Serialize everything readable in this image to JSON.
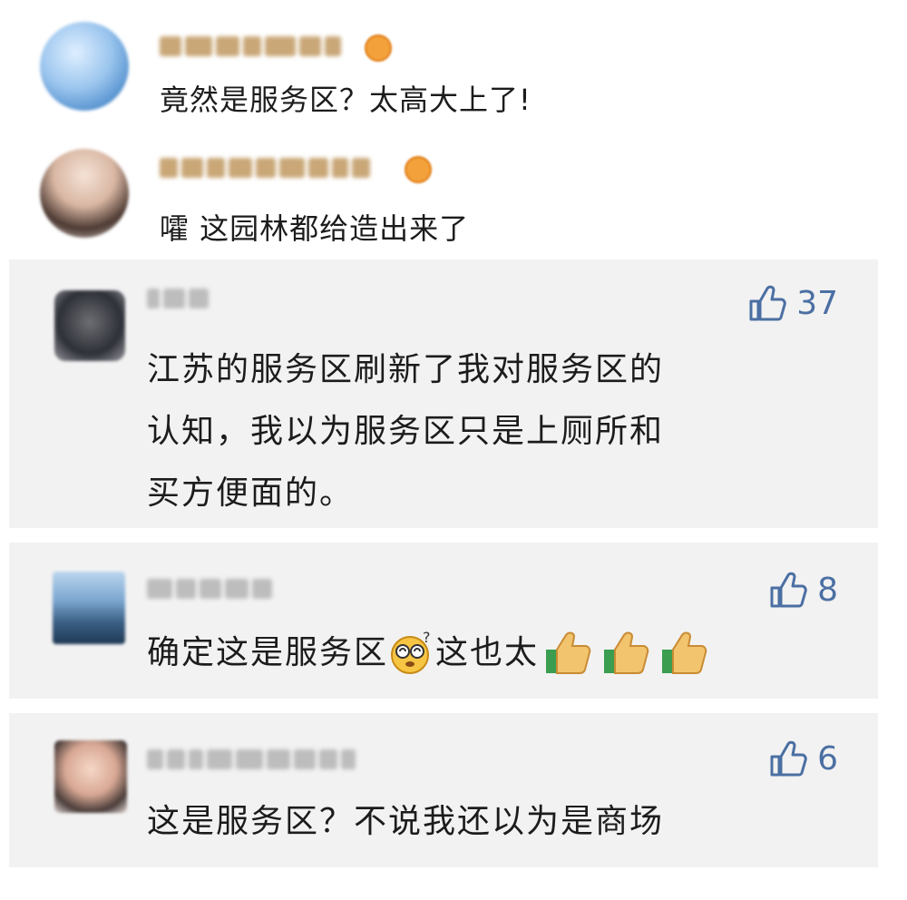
{
  "comments": [
    {
      "type": "plain",
      "text": "竟然是服务区？太高大上了!"
    },
    {
      "type": "plain",
      "text": "嚯 这园林都给造出来了"
    },
    {
      "type": "card",
      "likes": "37",
      "lines": [
        "江苏的服务区刷新了我对服务区的",
        "认知，我以为服务区只是上厕所和",
        "买方便面的。"
      ]
    },
    {
      "type": "card",
      "likes": "8",
      "text_a": "确定这是服务区",
      "text_b": "这也太",
      "emoji_a": "dizzy-face-icon",
      "emoji_b": "thumbs-up-icon"
    },
    {
      "type": "card",
      "likes": "6",
      "text": "这是服务区？不说我还以为是商场"
    }
  ],
  "colors": {
    "card_bg": "#f2f2f2",
    "like_blue": "#4b6fa3",
    "username_gold": "#c9a777"
  }
}
